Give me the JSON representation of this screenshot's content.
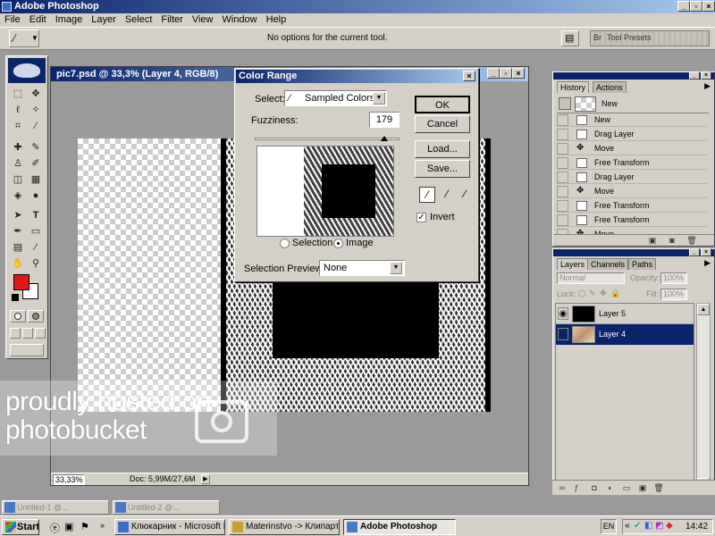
{
  "app": {
    "title": "Adobe Photoshop",
    "window_buttons": [
      "_",
      "▫",
      "×"
    ]
  },
  "menu": [
    "File",
    "Edit",
    "Image",
    "Layer",
    "Select",
    "Filter",
    "View",
    "Window",
    "Help"
  ],
  "options_bar": {
    "message": "No options for the current tool.",
    "br_label": "Br",
    "tool_presets": "Tool Presets"
  },
  "document": {
    "title": "pic7.psd @ 33,3% (Layer 4, RGB/8)",
    "zoom": "33,33%",
    "doc_size": "Doc: 5,99M/27,6M"
  },
  "color_range": {
    "title": "Color Range",
    "select_label": "Select:",
    "select_value": "Sampled Colors",
    "fuzziness_label": "Fuzziness:",
    "fuzziness_value": "179",
    "fuzziness_fraction": 0.9,
    "ok": "OK",
    "cancel": "Cancel",
    "load": "Load...",
    "save": "Save...",
    "invert_label": "Invert",
    "invert_checked": true,
    "radio_selection": "Selection",
    "radio_image": "Image",
    "radio_selected": "Image",
    "preview_label": "Selection Preview:",
    "preview_value": "None"
  },
  "history": {
    "tabs": [
      "History",
      "Actions"
    ],
    "snapshot_label": "New",
    "items": [
      "New",
      "Drag Layer",
      "Move",
      "Free Transform",
      "Drag Layer",
      "Move",
      "Free Transform",
      "Free Transform",
      "Move"
    ]
  },
  "layers": {
    "tabs": [
      "Layers",
      "Channels",
      "Paths"
    ],
    "blend_mode": "Normal",
    "opacity_label": "Opacity:",
    "opacity_value": "100%",
    "lock_label": "Lock:",
    "fill_label": "Fill:",
    "fill_value": "100%",
    "items": [
      {
        "name": "Layer 5",
        "selected": false
      },
      {
        "name": "Layer 4",
        "selected": true
      }
    ]
  },
  "minimized": [
    "Untitled-1 @...",
    "Untitled-2 @..."
  ],
  "taskbar": {
    "start": "Start",
    "tasks": [
      "Клюкарник - Microsoft I...",
      "Materinstvo -> Клипарт...",
      "Adobe Photoshop"
    ],
    "lang": "EN",
    "clock": "14:42"
  },
  "watermark": {
    "line1": "proudly hosted on",
    "line2": "photobucket"
  },
  "colors": {
    "foreground": "#e01818",
    "background": "#ffffff",
    "title_blue": "#0a246a",
    "selection_blue": "#0a246a"
  }
}
